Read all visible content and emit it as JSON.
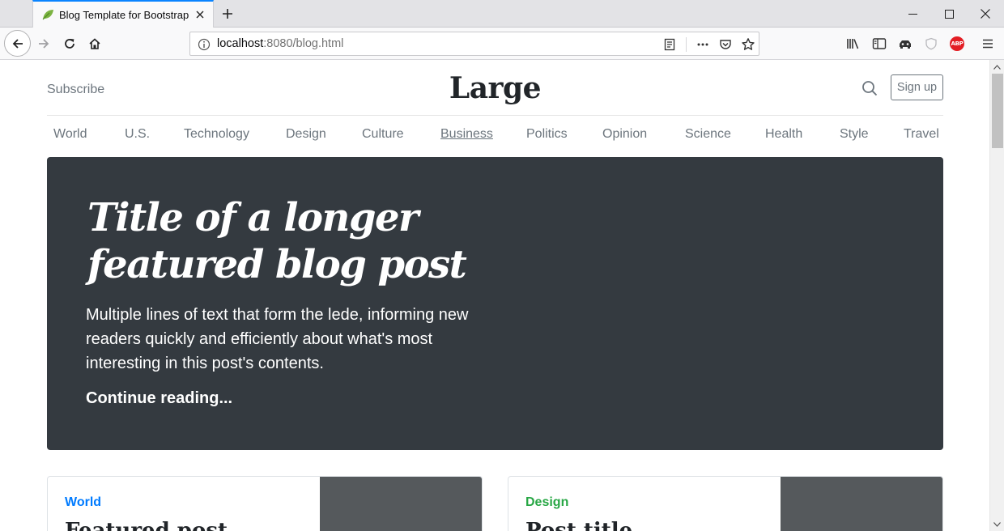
{
  "browser": {
    "tab": {
      "title": "Blog Template for Bootstrap"
    },
    "url": {
      "host": "localhost",
      "rest": ":8080/blog.html"
    }
  },
  "header": {
    "subscribe_label": "Subscribe",
    "logo": "Large",
    "signup_label": "Sign up"
  },
  "nav": {
    "items": [
      {
        "label": "World"
      },
      {
        "label": "U.S."
      },
      {
        "label": "Technology"
      },
      {
        "label": "Design"
      },
      {
        "label": "Culture"
      },
      {
        "label": "Business",
        "active": true
      },
      {
        "label": "Politics"
      },
      {
        "label": "Opinion"
      },
      {
        "label": "Science"
      },
      {
        "label": "Health"
      },
      {
        "label": "Style"
      },
      {
        "label": "Travel"
      }
    ]
  },
  "featured": {
    "title_line1": "Title of a longer",
    "title_line2": "featured blog post",
    "lede": "Multiple lines of text that form the lede, informing new readers quickly and efficiently about what's most interesting in this post's contents.",
    "link_label": "Continue reading..."
  },
  "cards": [
    {
      "category": "World",
      "category_color": "#007bff",
      "title": "Featured post"
    },
    {
      "category": "Design",
      "category_color": "#28a745",
      "title": "Post title"
    }
  ],
  "colors": {
    "tab_accent": "#0a84ff",
    "jumbotron_bg": "#343a40",
    "card_thumb_bg": "#55595c",
    "muted_text": "#6c757d"
  }
}
